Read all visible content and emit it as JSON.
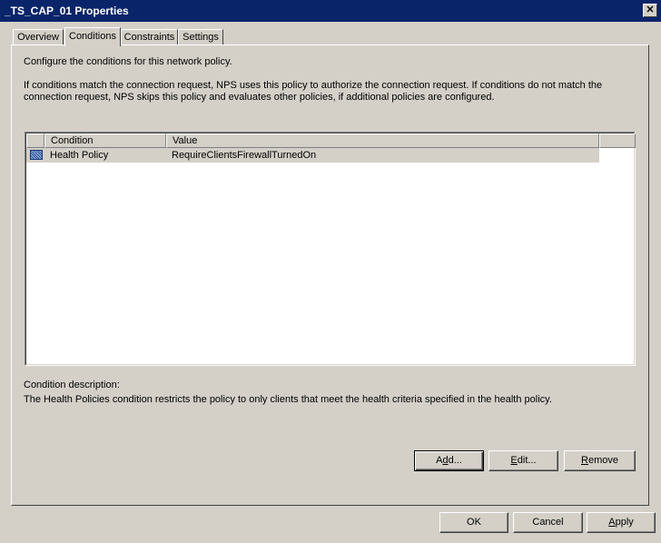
{
  "window": {
    "title": "_TS_CAP_01 Properties",
    "close_glyph": "✕"
  },
  "tabs": [
    {
      "label": "Overview",
      "active": false
    },
    {
      "label": "Conditions",
      "active": true
    },
    {
      "label": "Constraints",
      "active": false
    },
    {
      "label": "Settings",
      "active": false
    }
  ],
  "conditions": {
    "intro": "Configure the conditions for this network policy.",
    "explanation_line1": "If conditions match the connection request, NPS uses this policy to authorize the connection request. If conditions do not match the",
    "explanation_line2": "connection request, NPS skips this policy and evaluates other policies, if additional policies are configured.",
    "list": {
      "columns": [
        "Condition",
        "Value"
      ],
      "rows": [
        {
          "condition": "Health Policy",
          "value": "RequireClientsFirewallTurnedOn",
          "icon": "health-policy-icon"
        }
      ]
    },
    "description_label": "Condition description:",
    "description_text": "The Health Policies condition restricts the policy to only clients that meet the health criteria specified in the health policy.",
    "buttons": {
      "add": {
        "pre": "A",
        "u": "d",
        "post": "d..."
      },
      "edit": {
        "pre": "",
        "u": "E",
        "post": "dit..."
      },
      "remove": {
        "pre": "",
        "u": "R",
        "post": "emove"
      }
    }
  },
  "footer": {
    "ok": "OK",
    "cancel": "Cancel",
    "apply": {
      "pre": "",
      "u": "A",
      "post": "pply"
    }
  }
}
